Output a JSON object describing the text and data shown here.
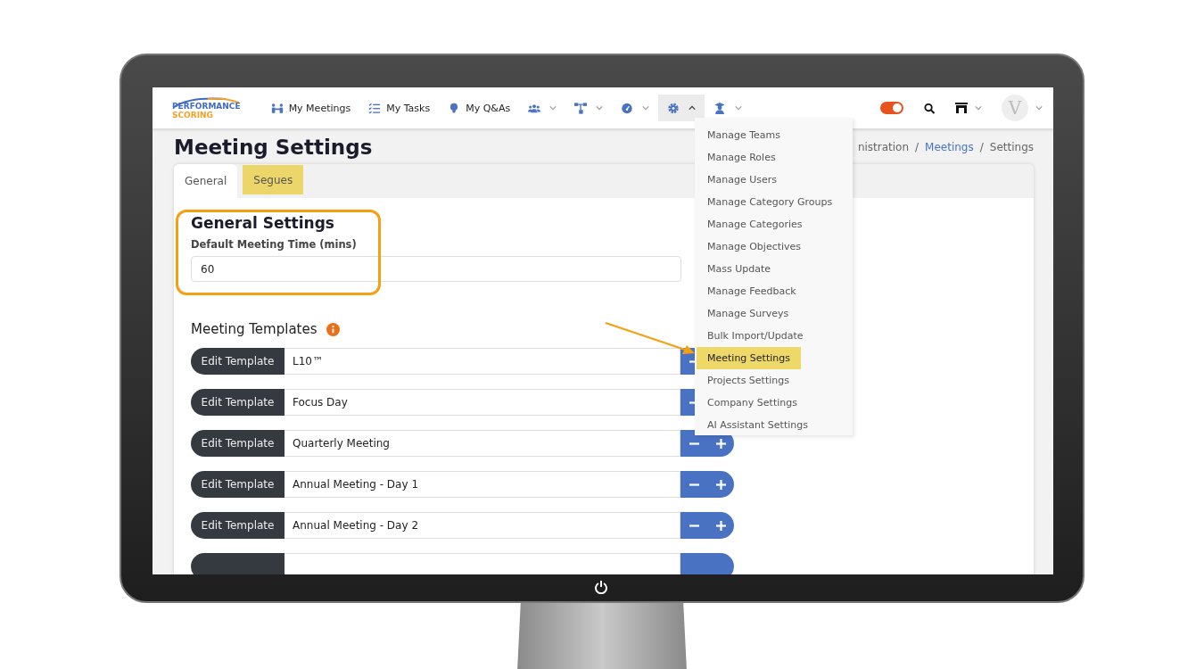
{
  "logo": {
    "line1": "PERFORMANCE",
    "line2": "SCORING"
  },
  "nav": [
    {
      "kind": "link",
      "label": "My Meetings"
    },
    {
      "kind": "link",
      "label": "My Tasks"
    },
    {
      "kind": "link",
      "label": "My Q&As"
    },
    {
      "kind": "menu",
      "expanded": false
    },
    {
      "kind": "menu",
      "expanded": false
    },
    {
      "kind": "menu",
      "expanded": false
    },
    {
      "kind": "menu",
      "expanded": true
    },
    {
      "kind": "menu",
      "expanded": false
    }
  ],
  "toolbar": {
    "toggle_on": true,
    "avatar": "V"
  },
  "page_title": "Meeting Settings",
  "breadcrumb": [
    {
      "label": "nistration",
      "link": false
    },
    {
      "separator": "/",
      "label": "Meetings",
      "link": true
    },
    {
      "separator": "/",
      "label": "Settings",
      "link": false
    }
  ],
  "tabs": [
    {
      "label": "General",
      "selected": true,
      "highlighted": false
    },
    {
      "label": "Segues",
      "selected": false,
      "highlighted": true
    }
  ],
  "general": {
    "heading": "General Settings",
    "field_label": "Default Meeting Time (mins)",
    "value": "60"
  },
  "templates_heading": "Meeting Templates",
  "templates": [
    {
      "button": "Edit Template",
      "name": "L10™"
    },
    {
      "button": "Edit Template",
      "name": "Focus Day"
    },
    {
      "button": "Edit Template",
      "name": "Quarterly Meeting"
    },
    {
      "button": "Edit Template",
      "name": "Annual Meeting - Day 1"
    },
    {
      "button": "Edit Template",
      "name": "Annual Meeting - Day 2"
    }
  ],
  "dropdown": [
    {
      "label": "Manage Teams",
      "selected": false
    },
    {
      "label": "Manage Roles",
      "selected": false
    },
    {
      "label": "Manage Users",
      "selected": false
    },
    {
      "label": "Manage Category Groups",
      "selected": false
    },
    {
      "label": "Manage Categories",
      "selected": false
    },
    {
      "label": "Manage Objectives",
      "selected": false
    },
    {
      "label": "Mass Update",
      "selected": false
    },
    {
      "label": "Manage Feedback",
      "selected": false
    },
    {
      "label": "Manage Surveys",
      "selected": false
    },
    {
      "label": "Bulk Import/Update",
      "selected": false
    },
    {
      "label": "Meeting Settings",
      "selected": true
    },
    {
      "label": "Projects Settings",
      "selected": false
    },
    {
      "label": "Company Settings",
      "selected": false
    },
    {
      "label": "AI Assistant Settings",
      "selected": false
    }
  ]
}
